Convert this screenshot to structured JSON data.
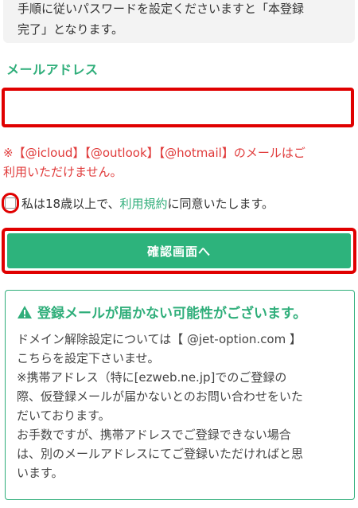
{
  "top_note": {
    "line1": "手順に従いパスワードを設定くださいますと「本登録",
    "line2": "完了」となります。"
  },
  "email": {
    "label": "メールアドレス",
    "value": "",
    "placeholder": ""
  },
  "warning": {
    "line1": "※【@icloud】【@outlook】【@hotmail】のメールはご",
    "line2": "利用いただけません。"
  },
  "agreement": {
    "prefix": "私は18歳以上で、",
    "terms_link": "利用規約",
    "suffix": "に同意いたします。",
    "checked": false
  },
  "confirm_button": {
    "label": "確認画面へ"
  },
  "notice": {
    "title": "登録メールが届かない可能性がございます。",
    "icon": "warning-triangle-icon",
    "lines": [
      "ドメイン解除設定については【 @jet-option.com 】",
      "こちらを設定下さいませ。",
      "※携帯アドレス（特に[ezweb.ne.jp]でのご登録の",
      "際、仮登録メールが届かないとのお問い合わせをいた",
      "だいております。",
      "お手数ですが、携帯アドレスでご登録できない場合",
      "は、別のメールアドレスにてご登録いただければと思",
      "います。"
    ]
  },
  "colors": {
    "accent_green": "#2fae7a",
    "button_green": "#2db37c",
    "warning_red": "#e03a3a",
    "highlight_red": "#e00000"
  }
}
